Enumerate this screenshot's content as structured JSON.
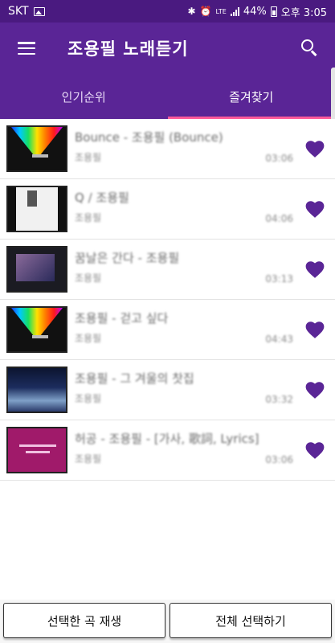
{
  "status_bar": {
    "carrier": "SKT",
    "lte": "LTE",
    "battery": "44%",
    "time": "오후 3:05"
  },
  "app_bar": {
    "title": "조용필 노래듣기"
  },
  "tabs": [
    {
      "label": "인기순위",
      "active": false
    },
    {
      "label": "즐겨찾기",
      "active": true
    }
  ],
  "songs": [
    {
      "title": "Bounce - 조용필 (Bounce)",
      "artist": "조용필",
      "duration": "03:06",
      "favorite": true
    },
    {
      "title": "Q / 조용필",
      "artist": "조용필",
      "duration": "04:06",
      "favorite": true
    },
    {
      "title": "꿈날은 간다 - 조용필",
      "artist": "조용필",
      "duration": "03:13",
      "favorite": true
    },
    {
      "title": "조용필 - 걷고 싶다",
      "artist": "조용필",
      "duration": "04:43",
      "favorite": true
    },
    {
      "title": "조용필 - 그 겨울의 찻집",
      "artist": "조용필",
      "duration": "03:32",
      "favorite": true
    },
    {
      "title": "허공 - 조용필 - [가사, 歌詞, Lyrics]",
      "artist": "조용필",
      "duration": "03:06",
      "favorite": true
    }
  ],
  "bottom_bar": {
    "play_selected": "선택한 곡 재생",
    "select_all": "전체 선택하기"
  },
  "colors": {
    "status_bar": "#4a1a80",
    "primary": "#5a2596",
    "tab_indicator": "#ff5a9a",
    "heart": "#5a2596"
  },
  "icons": {
    "menu": "hamburger-menu-icon",
    "search": "search-icon",
    "favorite": "heart-icon"
  }
}
